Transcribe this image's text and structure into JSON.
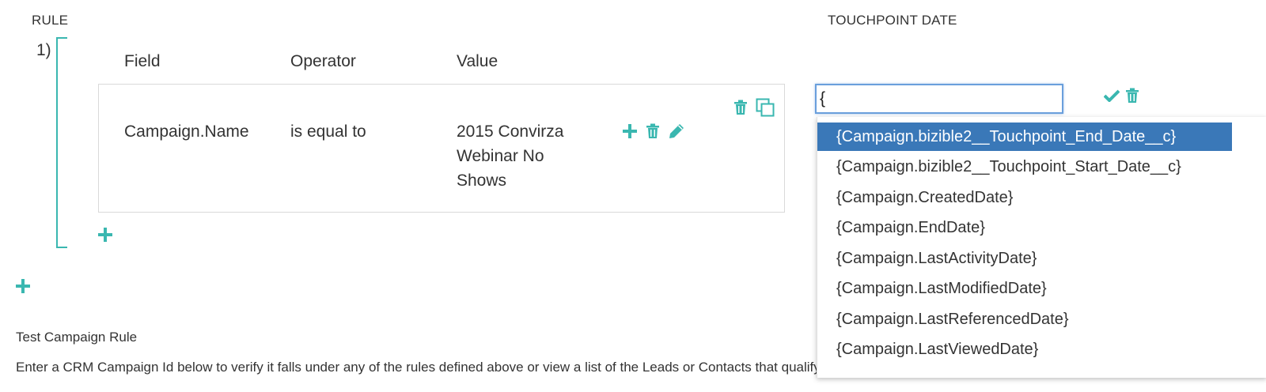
{
  "rule_section": {
    "header": "RULE",
    "rule_number": "1)",
    "columns": {
      "field": "Field",
      "operator": "Operator",
      "value": "Value"
    },
    "condition": {
      "field": "Campaign.Name",
      "operator": "is equal to",
      "value_lines": [
        "2015 Convirza",
        "Webinar No",
        "Shows"
      ]
    }
  },
  "touchpoint": {
    "header": "TOUCHPOINT DATE",
    "input_value": "{",
    "options": [
      "{Campaign.bizible2__Touchpoint_End_Date__c}",
      "{Campaign.bizible2__Touchpoint_Start_Date__c}",
      "{Campaign.CreatedDate}",
      "{Campaign.EndDate}",
      "{Campaign.LastActivityDate}",
      "{Campaign.LastModifiedDate}",
      "{Campaign.LastReferencedDate}",
      "{Campaign.LastViewedDate}"
    ],
    "selected_index": 0
  },
  "test_section": {
    "title": "Test Campaign Rule",
    "description": "Enter a CRM Campaign Id below to verify it falls under any of the rules defined above or view a list of the Leads or Contacts that qualify within the Campaign."
  },
  "icons": {
    "accent_color": "#3ab7b0",
    "selected_color": "#3a78b8",
    "names": [
      "plus-icon",
      "trash-icon",
      "pencil-icon",
      "copy-icon",
      "check-icon"
    ]
  }
}
